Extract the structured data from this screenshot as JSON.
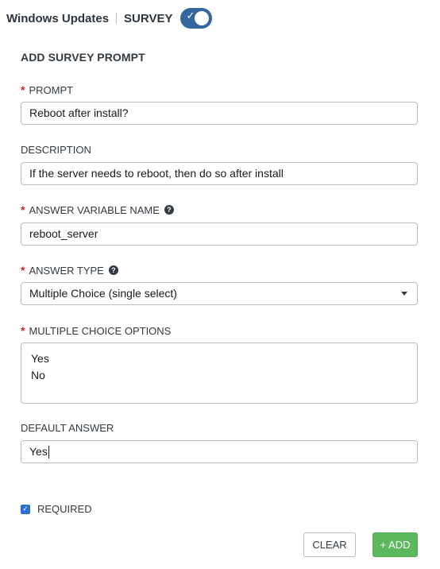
{
  "header": {
    "title": "Windows Updates",
    "survey_label": "SURVEY",
    "survey_enabled": true
  },
  "form": {
    "section_title": "ADD SURVEY PROMPT",
    "prompt": {
      "label": "PROMPT",
      "required": true,
      "value": "Reboot after install?"
    },
    "description": {
      "label": "DESCRIPTION",
      "required": false,
      "value": "If the server needs to reboot, then do so after install"
    },
    "answer_variable": {
      "label": "ANSWER VARIABLE NAME",
      "required": true,
      "value": "reboot_server"
    },
    "answer_type": {
      "label": "ANSWER TYPE",
      "required": true,
      "value": "Multiple Choice (single select)"
    },
    "multiple_choice": {
      "label": "MULTIPLE CHOICE OPTIONS",
      "required": true,
      "options": [
        "Yes",
        "No"
      ]
    },
    "default_answer": {
      "label": "DEFAULT ANSWER",
      "required": false,
      "value": "Yes"
    },
    "required_checkbox": {
      "label": "REQUIRED",
      "checked": true
    }
  },
  "actions": {
    "clear_label": "CLEAR",
    "add_label": "+ ADD"
  },
  "colors": {
    "toggle_on": "#33679d",
    "required_star": "#c9252b",
    "add_button": "#5cb85c",
    "checkbox": "#2d6fd1"
  }
}
